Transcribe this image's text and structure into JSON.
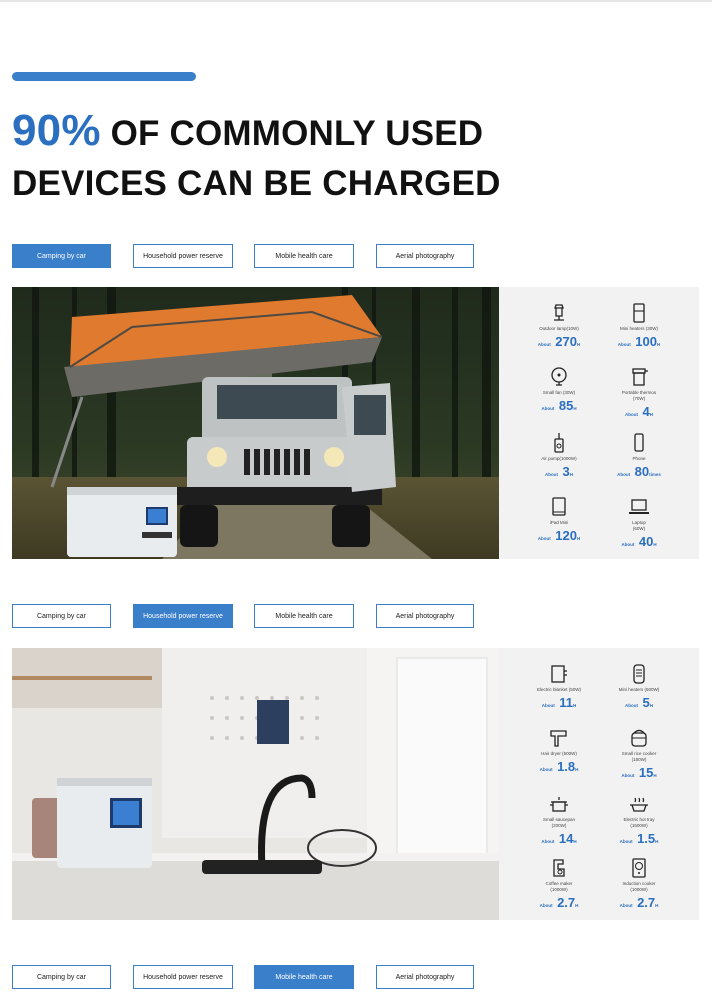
{
  "headline": {
    "percent": "90%",
    "line1_rest": " OF COMMONLY USED",
    "line2": "DEVICES CAN BE CHARGED"
  },
  "tabs": [
    "Camping by car",
    "Household power reserve",
    "Mobile health care",
    "Aerial photography"
  ],
  "colors": {
    "accent": "#3a7fc9",
    "value_blue": "#2a6fc0",
    "panel_bg": "#f2f2f2"
  },
  "camping_items": [
    {
      "icon": "lamp-icon",
      "label": "Outdoor lamp(10W)",
      "about": "About",
      "value": "270",
      "unit": "H"
    },
    {
      "icon": "mini-fridge-icon",
      "label": "Mini heaters (30W)",
      "about": "About",
      "value": "100",
      "unit": "H"
    },
    {
      "icon": "fan-icon",
      "label": "Small fan (30W)",
      "about": "About",
      "value": "85",
      "unit": "H"
    },
    {
      "icon": "thermos-icon",
      "label": "Portable thermos\n(70W)",
      "about": "About",
      "value": "4",
      "unit": "H"
    },
    {
      "icon": "air-pump-icon",
      "label": "Air pump(1000W)",
      "about": "About",
      "value": "3",
      "unit": "H"
    },
    {
      "icon": "phone-icon",
      "label": "Phone",
      "about": "About",
      "value": "80",
      "unit": "times"
    },
    {
      "icon": "tablet-icon",
      "label": "iPad Mini",
      "about": "About",
      "value": "120",
      "unit": "H"
    },
    {
      "icon": "laptop-icon",
      "label": "Laptop\n(60W)",
      "about": "About",
      "value": "40",
      "unit": "H"
    }
  ],
  "household_items": [
    {
      "icon": "electric-blanket-icon",
      "label": "Electric blanket (50W)",
      "about": "About",
      "value": "11",
      "unit": "H"
    },
    {
      "icon": "heater-icon",
      "label": "Mini heaters (500W)",
      "about": "About",
      "value": "5",
      "unit": "H"
    },
    {
      "icon": "hair-dryer-icon",
      "label": "Hair dryer (500W)",
      "about": "About",
      "value": "1.8",
      "unit": "H"
    },
    {
      "icon": "rice-cooker-icon",
      "label": "Small rice cooker\n(180W)",
      "about": "About",
      "value": "15",
      "unit": "H"
    },
    {
      "icon": "saucepan-icon",
      "label": "Small saucepan\n(200W)",
      "about": "About",
      "value": "14",
      "unit": "H"
    },
    {
      "icon": "grill-icon",
      "label": "Electric hot tray\n(1500W)",
      "about": "About",
      "value": "1.5",
      "unit": "H"
    },
    {
      "icon": "coffee-maker-icon",
      "label": "Coffee maker\n(1000W)",
      "about": "About",
      "value": "2.7",
      "unit": "H"
    },
    {
      "icon": "induction-cooker-icon",
      "label": "Induction cooker\n(1000W)",
      "about": "About",
      "value": "2.7",
      "unit": "H"
    }
  ]
}
